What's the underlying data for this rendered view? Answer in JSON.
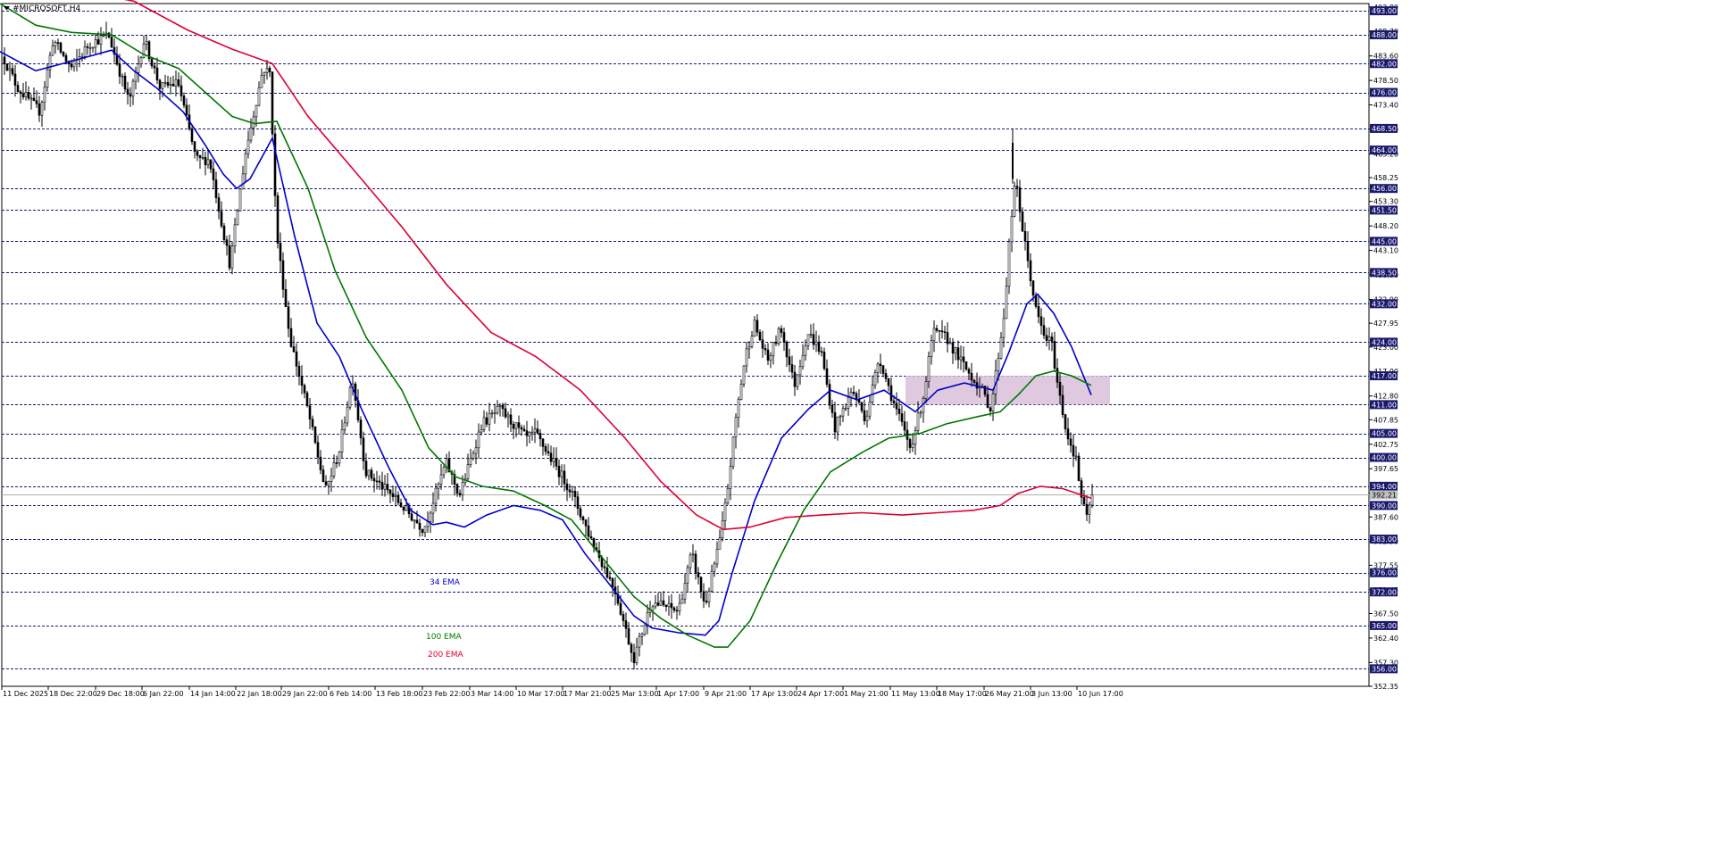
{
  "window": {
    "title": "#MICROSOFT,H4",
    "menu_icon": "triangle-down-icon"
  },
  "chart_data": {
    "type": "candlestick",
    "symbol": "#MICROSOFT",
    "timeframe": "H4",
    "ylim": [
      352.35,
      494.5
    ],
    "price_ticks": [
      493.8,
      488.7,
      483.6,
      478.5,
      473.4,
      468.3,
      463.2,
      458.25,
      453.3,
      448.2,
      443.1,
      438.0,
      432.9,
      427.95,
      423.0,
      417.9,
      412.8,
      407.85,
      402.75,
      397.65,
      392.55,
      387.6,
      382.5,
      377.55,
      372.45,
      367.5,
      362.4,
      357.3,
      352.35
    ],
    "x_labels": [
      "11 Dec 2025",
      "18 Dec 22:00",
      "29 Dec 18:00",
      "6 Jan 22:00",
      "14 Jan 14:00",
      "22 Jan 18:00",
      "29 Jan 22:00",
      "6 Feb 14:00",
      "13 Feb 18:00",
      "23 Feb 22:00",
      "3 Mar 14:00",
      "10 Mar 17:00",
      "17 Mar 21:00",
      "25 Mar 13:00",
      "1 Apr 17:00",
      "9 Apr 21:00",
      "17 Apr 13:00",
      "24 Apr 17:00",
      "1 May 21:00",
      "11 May 13:00",
      "18 May 17:00",
      "26 May 21:00",
      "3 Jun 13:00",
      "10 Jun 17:00"
    ],
    "current_price": 392.21,
    "horizontal_levels": [
      493.0,
      488.0,
      482.0,
      476.0,
      468.5,
      464.0,
      456.0,
      451.5,
      445.0,
      438.5,
      432.0,
      424.0,
      417.0,
      411.0,
      405.0,
      400.0,
      394.0,
      390.0,
      383.0,
      376.0,
      372.0,
      365.0,
      356.0
    ],
    "zone": {
      "from": 411.0,
      "to": 417.0,
      "start_label": "18 May 17:00",
      "color": "#d8bfd8"
    },
    "key_points": [
      [
        0,
        485
      ],
      [
        20,
        477
      ],
      [
        45,
        472
      ],
      [
        60,
        487
      ],
      [
        80,
        481
      ],
      [
        100,
        486
      ],
      [
        122,
        488
      ],
      [
        145,
        474
      ],
      [
        162,
        487
      ],
      [
        180,
        477
      ],
      [
        200,
        478
      ],
      [
        220,
        462
      ],
      [
        235,
        462
      ],
      [
        258,
        440
      ],
      [
        275,
        463
      ],
      [
        295,
        481
      ],
      [
        303,
        480
      ],
      [
        310,
        447
      ],
      [
        325,
        425
      ],
      [
        345,
        410
      ],
      [
        365,
        393
      ],
      [
        380,
        401
      ],
      [
        395,
        417
      ],
      [
        410,
        397
      ],
      [
        440,
        392
      ],
      [
        475,
        385
      ],
      [
        500,
        399
      ],
      [
        515,
        392
      ],
      [
        540,
        407
      ],
      [
        560,
        410
      ],
      [
        590,
        404
      ],
      [
        600,
        405
      ],
      [
        620,
        399
      ],
      [
        640,
        393
      ],
      [
        660,
        384
      ],
      [
        690,
        372
      ],
      [
        710,
        358
      ],
      [
        730,
        370
      ],
      [
        760,
        368
      ],
      [
        775,
        380
      ],
      [
        790,
        369
      ],
      [
        808,
        384
      ],
      [
        815,
        393
      ],
      [
        825,
        409
      ],
      [
        835,
        421
      ],
      [
        845,
        428
      ],
      [
        860,
        420
      ],
      [
        875,
        427
      ],
      [
        890,
        415
      ],
      [
        905,
        426
      ],
      [
        920,
        422
      ],
      [
        935,
        406
      ],
      [
        955,
        414
      ],
      [
        970,
        408
      ],
      [
        985,
        421
      ],
      [
        1000,
        412
      ],
      [
        1020,
        402
      ],
      [
        1035,
        413
      ],
      [
        1045,
        426
      ],
      [
        1060,
        425
      ],
      [
        1080,
        419
      ],
      [
        1100,
        414
      ],
      [
        1110,
        410
      ],
      [
        1125,
        430
      ],
      [
        1132,
        448
      ],
      [
        1138,
        458
      ],
      [
        1145,
        448
      ],
      [
        1155,
        437
      ],
      [
        1160,
        431
      ],
      [
        1170,
        425
      ],
      [
        1178,
        424
      ],
      [
        1185,
        415
      ],
      [
        1195,
        405
      ],
      [
        1205,
        400
      ],
      [
        1212,
        391
      ],
      [
        1218,
        387
      ],
      [
        1222,
        392
      ]
    ],
    "spikes": [
      {
        "x": 1134,
        "low": 457,
        "high": 468.5
      }
    ],
    "series": [
      {
        "name": "34 EMA",
        "color": "#0000cc",
        "points": [
          [
            0,
            484.5
          ],
          [
            40,
            480.5
          ],
          [
            80,
            482.5
          ],
          [
            125,
            484.8
          ],
          [
            150,
            480.5
          ],
          [
            175,
            477
          ],
          [
            205,
            472
          ],
          [
            230,
            465
          ],
          [
            250,
            459
          ],
          [
            265,
            456
          ],
          [
            280,
            458
          ],
          [
            305,
            466.5
          ],
          [
            330,
            446
          ],
          [
            355,
            428
          ],
          [
            380,
            421
          ],
          [
            405,
            410
          ],
          [
            435,
            398
          ],
          [
            460,
            389
          ],
          [
            485,
            386
          ],
          [
            500,
            386.5
          ],
          [
            520,
            385.5
          ],
          [
            545,
            388
          ],
          [
            575,
            390
          ],
          [
            605,
            389
          ],
          [
            630,
            387
          ],
          [
            655,
            380
          ],
          [
            685,
            373
          ],
          [
            710,
            367
          ],
          [
            730,
            364.5
          ],
          [
            760,
            363.5
          ],
          [
            790,
            363
          ],
          [
            805,
            366
          ],
          [
            820,
            376
          ],
          [
            845,
            391
          ],
          [
            875,
            404
          ],
          [
            905,
            410
          ],
          [
            930,
            414
          ],
          [
            960,
            412
          ],
          [
            990,
            414
          ],
          [
            1025,
            409.5
          ],
          [
            1050,
            414
          ],
          [
            1080,
            415.5
          ],
          [
            1112,
            414
          ],
          [
            1130,
            422
          ],
          [
            1150,
            432
          ],
          [
            1162,
            434
          ],
          [
            1180,
            430
          ],
          [
            1200,
            423
          ],
          [
            1222,
            413
          ]
        ]
      },
      {
        "name": "100 EMA",
        "color": "#007700",
        "points": [
          [
            0,
            494.5
          ],
          [
            40,
            490
          ],
          [
            80,
            488.5
          ],
          [
            125,
            488
          ],
          [
            160,
            484
          ],
          [
            200,
            481
          ],
          [
            230,
            476
          ],
          [
            260,
            471
          ],
          [
            285,
            469.5
          ],
          [
            310,
            470
          ],
          [
            345,
            456
          ],
          [
            375,
            439
          ],
          [
            410,
            425
          ],
          [
            450,
            414
          ],
          [
            480,
            402
          ],
          [
            510,
            396
          ],
          [
            540,
            394
          ],
          [
            575,
            393
          ],
          [
            610,
            390
          ],
          [
            640,
            387
          ],
          [
            675,
            379
          ],
          [
            710,
            371
          ],
          [
            740,
            366.5
          ],
          [
            770,
            363
          ],
          [
            800,
            360.5
          ],
          [
            815,
            360.5
          ],
          [
            840,
            366
          ],
          [
            870,
            378
          ],
          [
            900,
            389
          ],
          [
            930,
            397
          ],
          [
            965,
            401
          ],
          [
            995,
            404
          ],
          [
            1030,
            405
          ],
          [
            1060,
            407
          ],
          [
            1095,
            408.5
          ],
          [
            1120,
            409.5
          ],
          [
            1140,
            413
          ],
          [
            1160,
            417
          ],
          [
            1180,
            418
          ],
          [
            1200,
            417
          ],
          [
            1222,
            415
          ]
        ]
      },
      {
        "name": "200 EMA",
        "color": "#dd0033",
        "points": [
          [
            0,
            499
          ],
          [
            80,
            497.5
          ],
          [
            150,
            495
          ],
          [
            210,
            489
          ],
          [
            260,
            485
          ],
          [
            305,
            482
          ],
          [
            345,
            471
          ],
          [
            400,
            459
          ],
          [
            450,
            448
          ],
          [
            500,
            436
          ],
          [
            550,
            426
          ],
          [
            600,
            421
          ],
          [
            650,
            414
          ],
          [
            700,
            404
          ],
          [
            740,
            395
          ],
          [
            780,
            388
          ],
          [
            810,
            385
          ],
          [
            840,
            385.5
          ],
          [
            880,
            387.5
          ],
          [
            920,
            388
          ],
          [
            965,
            388.5
          ],
          [
            1010,
            388
          ],
          [
            1050,
            388.5
          ],
          [
            1090,
            389
          ],
          [
            1120,
            390
          ],
          [
            1140,
            392.5
          ],
          [
            1165,
            394
          ],
          [
            1190,
            393.5
          ],
          [
            1222,
            391.5
          ]
        ]
      }
    ],
    "legend_labels": [
      {
        "text": "34 EMA",
        "color": "#0000cc"
      },
      {
        "text": "100 EMA",
        "color": "#007700"
      },
      {
        "text": "200 EMA",
        "color": "#dd0033"
      }
    ],
    "grid": false,
    "price_axis_position": "right"
  }
}
